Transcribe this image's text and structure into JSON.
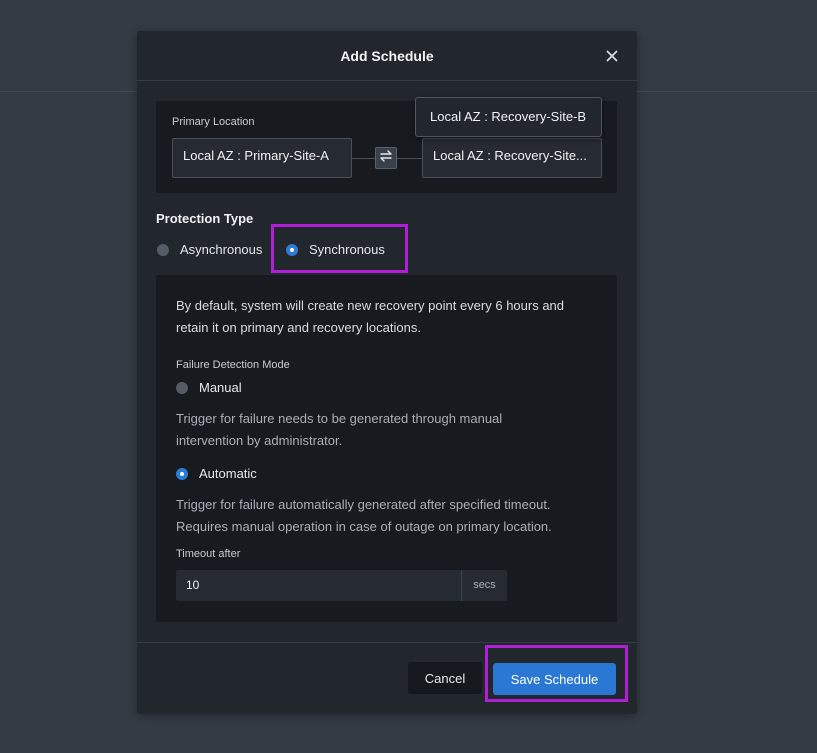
{
  "modal": {
    "title": "Add Schedule",
    "close_icon": "close-icon"
  },
  "location": {
    "label": "Primary Location",
    "primary_value": "Local AZ : Primary-Site-A",
    "recovery_value": "Local AZ : Recovery-Site-B",
    "recovery_display": "Local AZ : Recovery-Site...",
    "swap_icon": "swap-arrows-icon",
    "tooltip": "Local AZ : Recovery-Site-B"
  },
  "protection": {
    "title": "Protection Type",
    "options": [
      {
        "label": "Asynchronous",
        "selected": false
      },
      {
        "label": "Synchronous",
        "selected": true
      }
    ]
  },
  "panel": {
    "intro_line1": "By default, system will create new recovery point every 6 hours and",
    "intro_line2": "retain it on primary and recovery locations.",
    "failure_mode_label": "Failure Detection Mode",
    "manual_label": "Manual",
    "manual_desc_line1": "Trigger for failure needs to be generated through manual",
    "manual_desc_line2": "intervention by administrator.",
    "automatic_label": "Automatic",
    "automatic_desc_line1": "Trigger for failure automatically generated after specified timeout.",
    "automatic_desc_line2": "Requires manual operation in case of outage on primary location.",
    "timeout_label": "Timeout after",
    "timeout_value": "10",
    "timeout_unit": "secs"
  },
  "footer": {
    "cancel_label": "Cancel",
    "save_label": "Save Schedule"
  },
  "colors": {
    "accent": "#2b77d4",
    "highlight": "#b01ed6",
    "background": "#353b45",
    "modal": "#22262d"
  }
}
